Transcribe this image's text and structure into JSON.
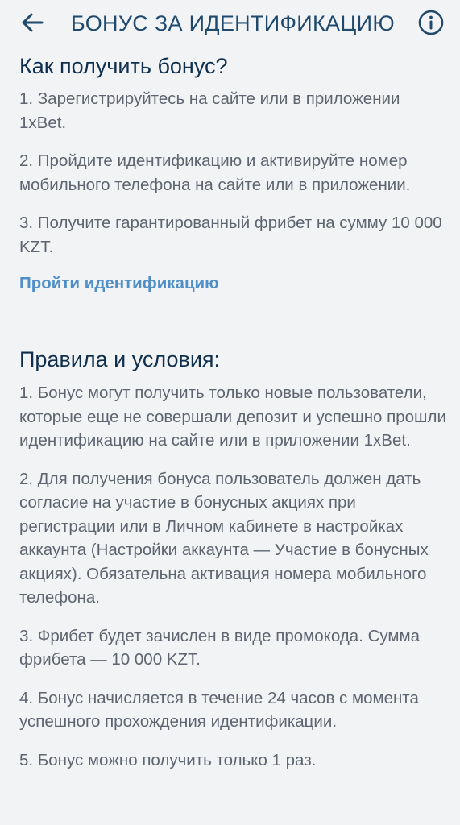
{
  "header": {
    "title": "БОНУС ЗА ИДЕНТИФИКАЦИЮ",
    "back_icon": "arrow-left-icon",
    "info_icon": "info-icon"
  },
  "section_how": {
    "title": "Как получить бонус?",
    "steps": [
      "1. Зарегистрируйтесь на сайте или в приложении 1xBet.",
      "2. Пройдите идентификацию и активируйте номер мобильного телефона на сайте или в приложении.",
      "3. Получите гарантированный фрибет на сумму 10 000 KZT."
    ],
    "link": "Пройти идентификацию"
  },
  "section_rules": {
    "title": "Правила и условия:",
    "rules": [
      "1. Бонус могут получить только новые пользователи, которые еще не совершали депозит и успешно прошли идентификацию на сайте или в приложении 1xBet.",
      "2. Для получения бонуса пользователь должен дать согласие на участие в бонусных акциях при регистрации или в Личном кабинете в настройках аккаунта (Настройки аккаунта — Участие в бонусных акциях). Обязательна активация номера мобильного телефона.",
      "3. Фрибет будет зачислен в виде промокода. Сумма фрибета — 10 000 KZT.",
      "4. Бонус начисляется в течение 24 часов с момента успешного прохождения идентификации.",
      "5. Бонус можно получить только 1 раз."
    ]
  },
  "colors": {
    "background": "#f2f3f5",
    "title": "#1f4a6e",
    "heading": "#0f2f4c",
    "body_text": "#5e6570",
    "link": "#4f8ec7"
  }
}
